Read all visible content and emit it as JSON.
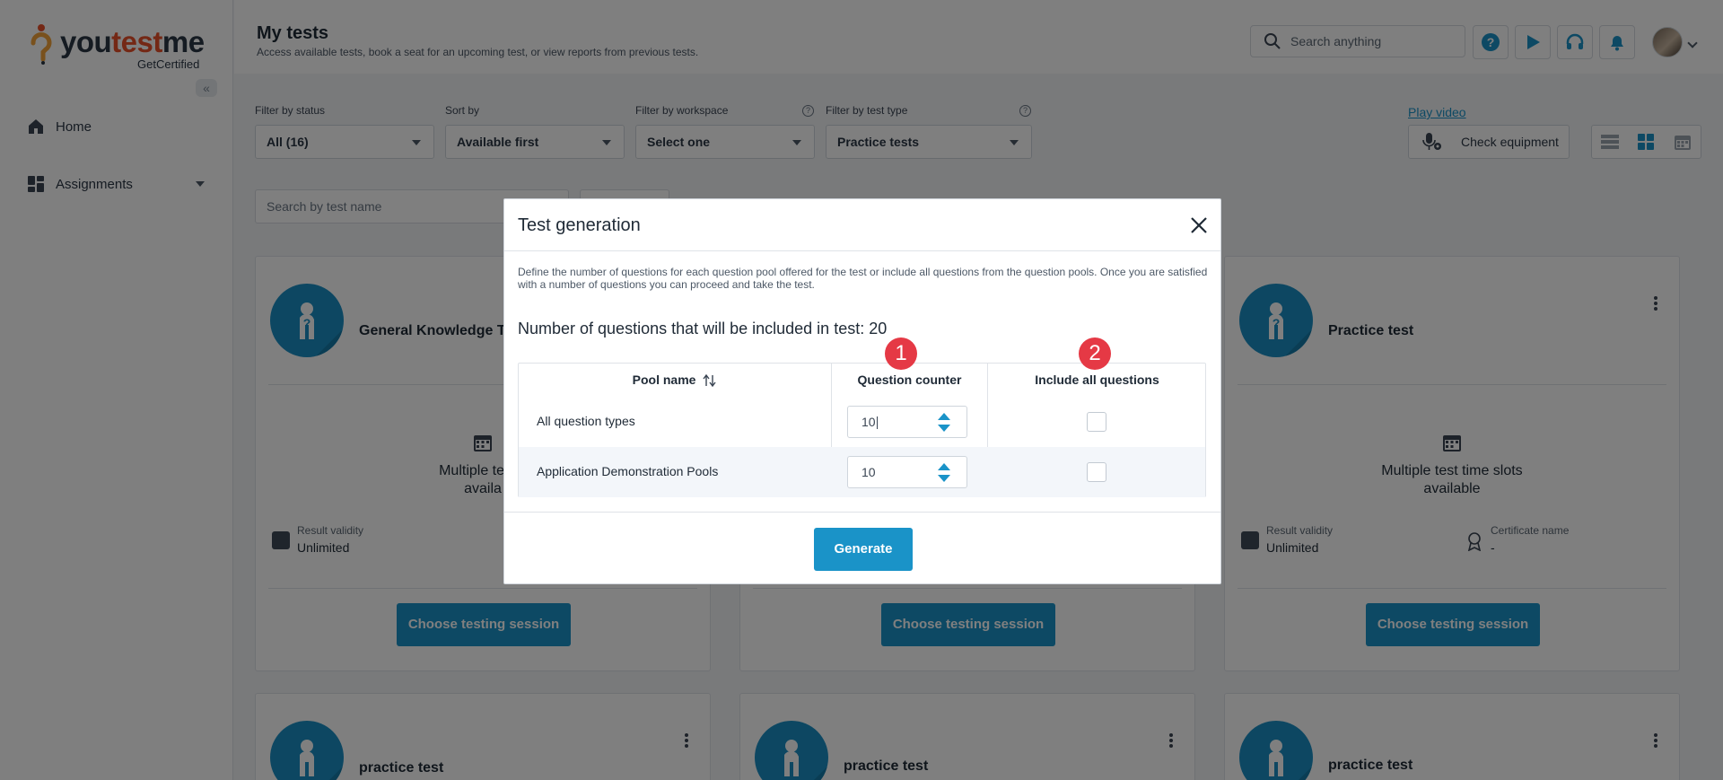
{
  "brand": {
    "name_a": "you",
    "name_b": "test",
    "name_c": "me",
    "subtitle": "GetCertified"
  },
  "sidebar": {
    "items": [
      {
        "label": "Home",
        "icon": "home-icon"
      },
      {
        "label": "Assignments",
        "icon": "assignments-icon"
      }
    ]
  },
  "header": {
    "title": "My tests",
    "subtitle": "Access available tests, book a seat for an upcoming test, or view reports from previous tests.",
    "search_placeholder": "Search anything"
  },
  "filters": {
    "status": {
      "label": "Filter by status",
      "value": "All (16)"
    },
    "sort": {
      "label": "Sort by",
      "value": "Available first"
    },
    "workspace": {
      "label": "Filter by workspace",
      "value": "Select one"
    },
    "test_type": {
      "label": "Filter by test type",
      "value": "Practice tests"
    },
    "play_video": "Play video",
    "check_equipment": "Check equipment",
    "test_search_placeholder": "Search by test name"
  },
  "cards": [
    {
      "title": "General Knowledge Te",
      "slots": "Multiple test ti​",
      "slots2": "availa",
      "validity_label": "Result validity",
      "validity_value": "Unlimited",
      "button": "Choose testing session"
    },
    {
      "title": "",
      "button": "Choose testing session"
    },
    {
      "title": "Practice test",
      "slots": "Multiple test time slots",
      "slots2": "available",
      "validity_label": "Result validity",
      "validity_value": "Unlimited",
      "cert_label": "Certificate name",
      "cert_value": "-",
      "button": "Choose testing session"
    },
    {
      "title": "practice test"
    },
    {
      "title": "practice test"
    },
    {
      "title": "practice test"
    }
  ],
  "modal": {
    "title": "Test generation",
    "description": "Define the number of questions for each question pool offered for the test or include all questions from the question pools. Once you are satisfied with a number of questions you can proceed and take the test.",
    "count_text": "Number of questions that will be included in test: 20",
    "columns": {
      "pool": "Pool name",
      "counter": "Question counter",
      "include": "Include all questions"
    },
    "rows": [
      {
        "name": "All question types",
        "counter": "10",
        "include_all": false
      },
      {
        "name": "Application Demonstration Pools",
        "counter": "10",
        "include_all": false
      }
    ],
    "badges": [
      "1",
      "2"
    ],
    "generate_label": "Generate"
  },
  "colors": {
    "accent": "#1a93c8",
    "badge": "#e53945",
    "overlay": "rgba(0,0,0,0.5)"
  }
}
